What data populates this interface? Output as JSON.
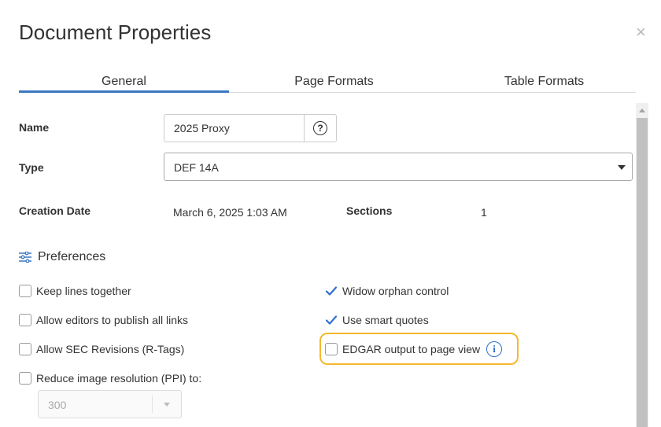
{
  "dialog": {
    "title": "Document Properties",
    "close_glyph": "×"
  },
  "tabs": [
    {
      "label": "General",
      "active": true
    },
    {
      "label": "Page Formats",
      "active": false
    },
    {
      "label": "Table Formats",
      "active": false
    }
  ],
  "fields": {
    "name_label": "Name",
    "name_value": "2025 Proxy",
    "help_glyph": "?",
    "type_label": "Type",
    "type_value": "DEF 14A",
    "creation_date_label": "Creation Date",
    "creation_date_value": "March 6, 2025 1:03 AM",
    "sections_label": "Sections",
    "sections_value": "1"
  },
  "preferences": {
    "heading": "Preferences",
    "icon": "sliders-icon",
    "left": [
      {
        "label": "Keep lines together",
        "checked": false
      },
      {
        "label": "Allow editors to publish all links",
        "checked": false
      },
      {
        "label": "Allow SEC Revisions (R-Tags)",
        "checked": false
      },
      {
        "label": "Reduce image resolution (PPI) to:",
        "checked": false
      }
    ],
    "right": [
      {
        "label": "Widow orphan control",
        "checked": true
      },
      {
        "label": "Use smart quotes",
        "checked": true
      },
      {
        "label": "EDGAR output to page view",
        "checked": false,
        "highlighted": true,
        "info_glyph": "i"
      }
    ],
    "ppi_value": "300"
  },
  "colors": {
    "accent": "#3a77c2",
    "check": "#2f6fd1",
    "highlight": "#f5b82e"
  }
}
